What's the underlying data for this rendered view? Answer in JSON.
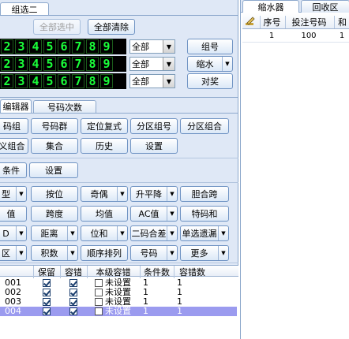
{
  "top_tab": {
    "label": "组选二"
  },
  "buttons_top": {
    "select_all": "全部选中",
    "clear_all": "全部清除"
  },
  "digit_rows": [
    {
      "digits": [
        "2",
        "3",
        "4",
        "5",
        "6",
        "7",
        "8",
        "9"
      ]
    },
    {
      "digits": [
        "2",
        "3",
        "4",
        "5",
        "6",
        "7",
        "8",
        "9"
      ]
    },
    {
      "digits": [
        "2",
        "3",
        "4",
        "5",
        "6",
        "7",
        "8",
        "9"
      ]
    }
  ],
  "dropdowns": [
    {
      "value": "全部"
    },
    {
      "value": "全部"
    },
    {
      "value": "全部"
    }
  ],
  "right_buttons": {
    "group": "组号",
    "shrink": "缩水",
    "award": "对奖"
  },
  "mid_tabs": [
    {
      "label": "编辑器"
    },
    {
      "label": "号码次数"
    }
  ],
  "editor_buttons": {
    "row1": [
      "码组",
      "号码群",
      "定位复式",
      "分区组号",
      "分区组合"
    ],
    "row2": [
      "义组合",
      "集合",
      "历史",
      "设置"
    ],
    "row3": [
      "条件",
      "设置"
    ]
  },
  "filter_rows": [
    [
      {
        "label": "型",
        "arrow": true
      },
      {
        "label": "按位",
        "arrow": false
      },
      {
        "label": "奇偶",
        "arrow": true
      },
      {
        "label": "升平降",
        "arrow": true
      },
      {
        "label": "胆合跨",
        "arrow": false
      }
    ],
    [
      {
        "label": "值",
        "arrow": false
      },
      {
        "label": "跨度",
        "arrow": false
      },
      {
        "label": "均值",
        "arrow": false
      },
      {
        "label": "AC值",
        "arrow": true
      },
      {
        "label": "特码和",
        "arrow": false
      }
    ],
    [
      {
        "label": "D",
        "arrow": true
      },
      {
        "label": "距离",
        "arrow": true
      },
      {
        "label": "位和",
        "arrow": true
      },
      {
        "label": "二码合差",
        "arrow": true
      },
      {
        "label": "单选遗漏",
        "arrow": true
      }
    ],
    [
      {
        "label": "区",
        "arrow": true
      },
      {
        "label": "积数",
        "arrow": true
      },
      {
        "label": "顺序排列",
        "arrow": false
      },
      {
        "label": "号码",
        "arrow": true
      },
      {
        "label": "更多",
        "arrow": true
      }
    ]
  ],
  "grid": {
    "headers": [
      "保留",
      "容错",
      "本级容错",
      "条件数",
      "容错数"
    ],
    "rows": [
      {
        "name": "001",
        "keep": true,
        "tol": true,
        "level_tol": "未设置",
        "cond": "1",
        "tolcount": "1"
      },
      {
        "name": "002",
        "keep": true,
        "tol": true,
        "level_tol": "未设置",
        "cond": "1",
        "tolcount": "1"
      },
      {
        "name": "003",
        "keep": true,
        "tol": true,
        "level_tol": "未设置",
        "cond": "1",
        "tolcount": "1"
      },
      {
        "name": "004",
        "keep": true,
        "tol": true,
        "level_tol": "未设置",
        "cond": "1",
        "tolcount": "1"
      }
    ],
    "selected_row": 3
  },
  "right_panel": {
    "tabs": [
      {
        "label": "缩水器"
      },
      {
        "label": "回收区"
      }
    ],
    "headers": [
      "序号",
      "投注号码",
      "和"
    ],
    "rows": [
      {
        "index": "1",
        "number": "100",
        "sum": "1"
      }
    ]
  },
  "colors": {
    "accent": "#6f93c3",
    "digit": "#1aff3a",
    "selected_row": "#9b9bef"
  }
}
